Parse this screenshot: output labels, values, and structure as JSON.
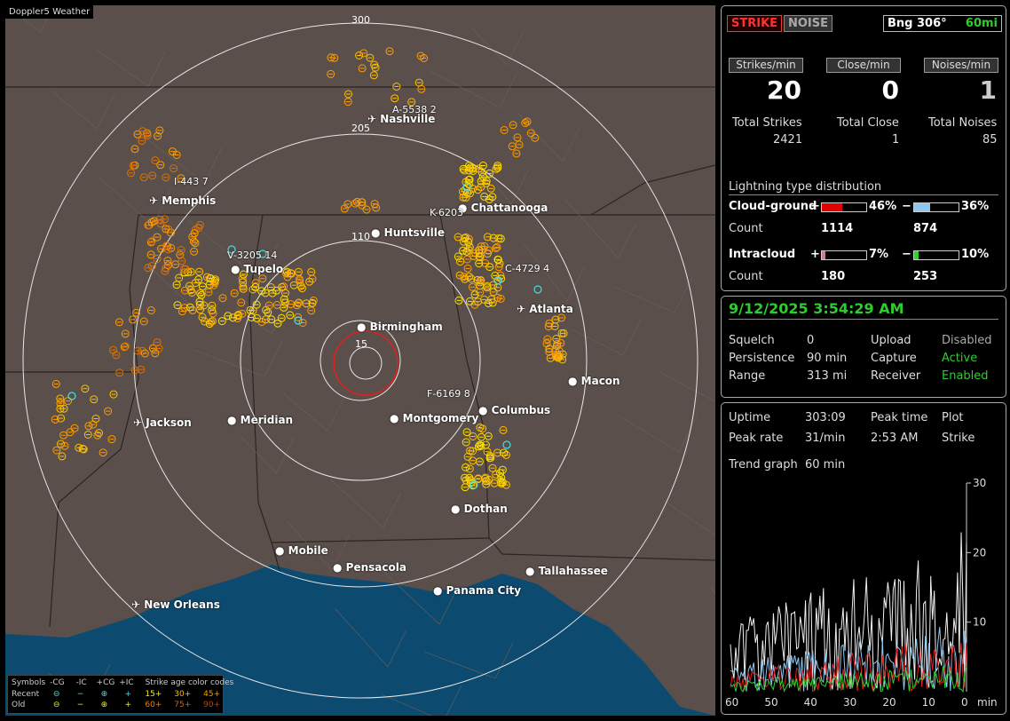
{
  "app": {
    "title": "Doppler5 Weather"
  },
  "map": {
    "ring_labels": [
      "300",
      "205",
      "110",
      "15"
    ],
    "cities": [
      {
        "name": "Nashville",
        "plane": true
      },
      {
        "name": "Memphis",
        "plane": true
      },
      {
        "name": "Huntsville",
        "plane": false
      },
      {
        "name": "Chattanooga",
        "plane": false
      },
      {
        "name": "Tupelo",
        "plane": false
      },
      {
        "name": "Atlanta",
        "plane": true
      },
      {
        "name": "Birmingham",
        "plane": false
      },
      {
        "name": "Macon",
        "plane": false
      },
      {
        "name": "Columbus",
        "plane": false
      },
      {
        "name": "Jackson",
        "plane": true
      },
      {
        "name": "Meridian",
        "plane": false
      },
      {
        "name": "Montgomery",
        "plane": false
      },
      {
        "name": "Dothan",
        "plane": false
      },
      {
        "name": "Mobile",
        "plane": false
      },
      {
        "name": "Pensacola",
        "plane": false
      },
      {
        "name": "Tallahassee",
        "plane": false
      },
      {
        "name": "Panama City",
        "plane": false
      },
      {
        "name": "New Orleans",
        "plane": true
      }
    ],
    "storm_tags": [
      "A-5538 2",
      "I-443 7",
      "K-6203",
      "C-4729 4",
      "F-6169 8",
      "V-3205 14"
    ],
    "legend": {
      "symbols_label": "Symbols",
      "cols": [
        "-CG",
        "-IC",
        "+CG",
        "+IC"
      ],
      "age_label": "Strike age color codes",
      "recent_label": "Recent",
      "old_label": "Old",
      "recent_ages": [
        "15+",
        "30+",
        "45+"
      ],
      "old_ages": [
        "60+",
        "75+",
        "90+"
      ]
    }
  },
  "status": {
    "strike_btn": "STRIKE",
    "noise_btn": "NOISE",
    "bearing": "Bng 306°",
    "bearing_range": "60mi",
    "strikes_min_label": "Strikes/min",
    "close_min_label": "Close/min",
    "noises_min_label": "Noises/min",
    "strikes_min": "20",
    "close_min": "0",
    "noises_min": "1",
    "total_strikes_label": "Total Strikes",
    "total_close_label": "Total Close",
    "total_noises_label": "Total Noises",
    "total_strikes": "2421",
    "total_close": "1",
    "total_noises": "85",
    "dist_title": "Lightning type distribution",
    "cg_label": "Cloud-ground",
    "ic_label": "Intracloud",
    "count_label": "Count",
    "plus": "+",
    "minus": "−",
    "cg_pos_pct": "46%",
    "cg_neg_pct": "36%",
    "cg_pos_count": "1114",
    "cg_neg_count": "874",
    "ic_pos_pct": "7%",
    "ic_neg_pct": "10%",
    "ic_pos_count": "180",
    "ic_neg_count": "253",
    "cg_pos_frac": 0.46,
    "cg_neg_frac": 0.36,
    "ic_pos_frac": 0.07,
    "ic_neg_frac": 0.1
  },
  "settings": {
    "datetime": "9/12/2025 3:54:29 AM",
    "squelch_label": "Squelch",
    "squelch": "0",
    "persistence_label": "Persistence",
    "persistence": "90 min",
    "range_label": "Range",
    "range": "313 mi",
    "upload_label": "Upload",
    "upload": "Disabled",
    "capture_label": "Capture",
    "capture": "Active",
    "receiver_label": "Receiver",
    "receiver": "Enabled"
  },
  "trend": {
    "uptime_label": "Uptime",
    "uptime": "303:09",
    "peak_time_label": "Peak time",
    "peak_time": "2:53 AM",
    "plot_label": "Plot",
    "plot": "Strike",
    "peak_rate_label": "Peak rate",
    "peak_rate": "31/min",
    "trend_label": "Trend graph",
    "trend_window": "60 min",
    "y_ticks": [
      "30",
      "20",
      "10"
    ],
    "x_ticks": [
      "60",
      "50",
      "40",
      "30",
      "20",
      "10",
      "0"
    ],
    "x_unit": "min"
  },
  "colors": {
    "accent_green": "#2ecc2e",
    "strike_red": "#ff3030",
    "cg_pos": "#e00000",
    "cg_neg": "#8ec8f0",
    "ic_pos": "#e070b0",
    "ic_neg": "#30d030"
  }
}
